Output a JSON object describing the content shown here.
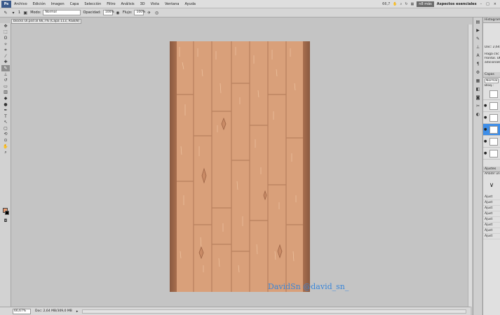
{
  "app": {
    "logo": "Ps",
    "menu": [
      "Archivo",
      "Edición",
      "Imagen",
      "Capa",
      "Selección",
      "Filtro",
      "Análisis",
      "3D",
      "Vista",
      "Ventana",
      "Ayuda"
    ],
    "zoom_display": "66,7",
    "mini_badge": "n8 más",
    "workspace": "Aspectos esenciales",
    "win_controls": [
      "–",
      "□",
      "×"
    ]
  },
  "options": {
    "mode_label": "Modo:",
    "mode_value": "Normal",
    "opacity_label": "Opacidad:",
    "opacity_value": "100%",
    "flow_label": "Flujo:",
    "flow_value": "100%",
    "brush_size": "1"
  },
  "document": {
    "tab_title": "blocks UI.psd al 66,7% (Capa 113, RGB/8)",
    "watermark": "DavidSn @david_sn_"
  },
  "status": {
    "zoom": "66,67%",
    "doc_size": "Doc: 2,64 MB/309,0 MB"
  },
  "panels": {
    "histogram_tab": "Histograma",
    "info_lines": [
      "Doc: 2,64",
      "Haga clic",
      "frontal. Ut",
      "adicionale"
    ],
    "layers_tab": "Capas",
    "blend_mode": "Normal",
    "lock_label": "Bloq.:",
    "adjust_tab": "Ajustes",
    "adjust_title": "Añadir un",
    "adjust_items": [
      "Ajust",
      "Ajust",
      "Ajust",
      "Ajust",
      "Ajust",
      "Ajust",
      "Ajust",
      "Ajust"
    ]
  },
  "colors": {
    "foreground": "#e89a70",
    "background": "#000000",
    "wood": "#d9a07a",
    "selected_layer": "#3e8ee8"
  }
}
